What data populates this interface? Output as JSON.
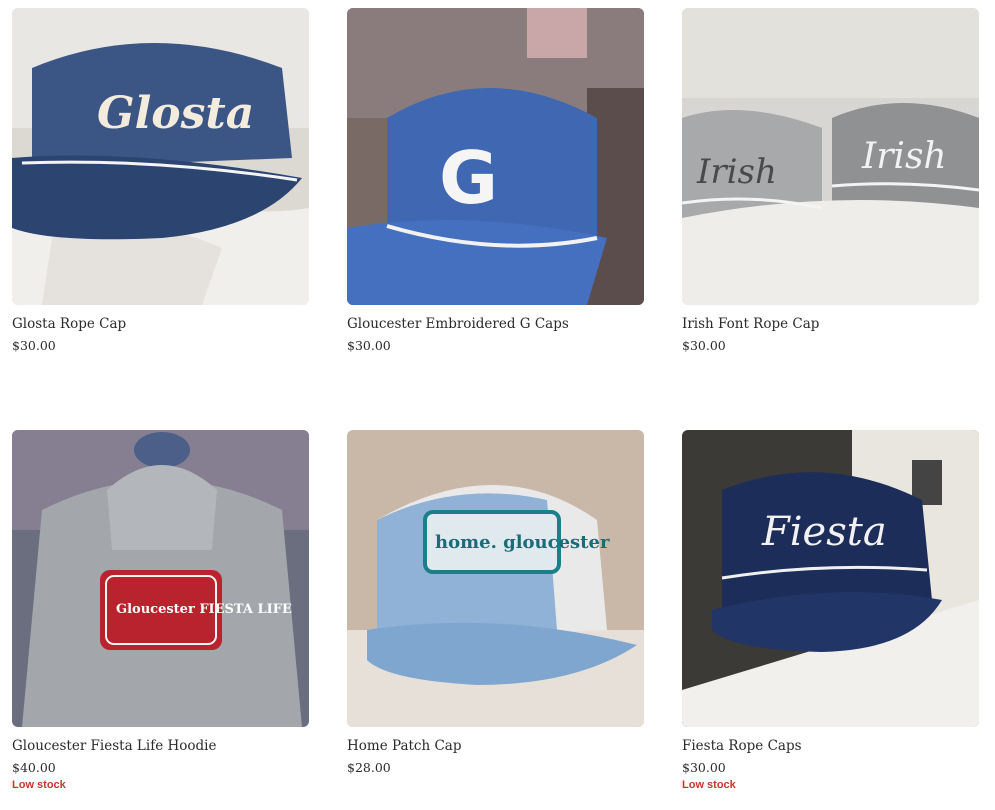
{
  "products": [
    {
      "title": "Glosta Rope Cap",
      "price": "$30.00",
      "badge": "",
      "image_text": "Glosta",
      "image": "navy-rope-cap"
    },
    {
      "title": "Gloucester Embroidered G Caps",
      "price": "$30.00",
      "badge": "",
      "image_text": "G",
      "image": "blue-g-cap"
    },
    {
      "title": "Irish Font Rope Cap",
      "price": "$30.00",
      "badge": "",
      "image_text": "Irish",
      "image": "grey-irish-caps"
    },
    {
      "title": "Gloucester Fiesta Life Hoodie",
      "price": "$40.00",
      "badge": "Low stock",
      "image_text": "Gloucester FIESTA LIFE",
      "image": "grey-hoodie"
    },
    {
      "title": "Home Patch Cap",
      "price": "$28.00",
      "badge": "",
      "image_text": "home. gloucester",
      "image": "blue-trucker-cap"
    },
    {
      "title": "Fiesta Rope Caps",
      "price": "$30.00",
      "badge": "Low stock",
      "image_text": "Fiesta",
      "image": "navy-fiesta-cap"
    }
  ],
  "colors": {
    "badge": "#c0392b",
    "text": "#2a2a2a",
    "navy": "#2f4a7a",
    "royal_blue": "#3e62a8",
    "grey_cap": "#9a9c9e",
    "hoodie_grey": "#9ea1a6",
    "light_denim": "#8fb2d6",
    "dark_navy": "#1c2d59"
  }
}
